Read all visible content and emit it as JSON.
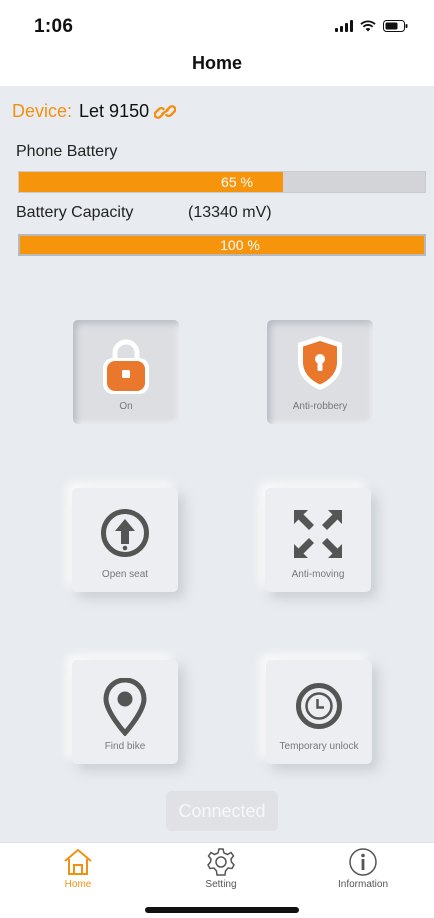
{
  "status_bar": {
    "time": "1:06"
  },
  "header": {
    "title": "Home"
  },
  "device": {
    "label": "Device:",
    "name": "Let 9150"
  },
  "phone_battery": {
    "label": "Phone Battery",
    "value_text": "65 %",
    "fraction": 0.65
  },
  "battery_capacity": {
    "label": "Battery Capacity",
    "voltage": "(13340 mV)",
    "value_text": "100 %",
    "fraction": 1.0
  },
  "controls": {
    "lock": {
      "label": "On",
      "icon": "padlock-icon"
    },
    "anti_robbery": {
      "label": "Anti-robbery",
      "icon": "shield-keyhole-icon"
    },
    "open_seat": {
      "label": "Open seat",
      "icon": "up-arrow-circle-icon"
    },
    "anti_moving": {
      "label": "Anti-moving",
      "icon": "arrows-inward-icon"
    },
    "find_bike": {
      "label": "Find bike",
      "icon": "map-pin-icon"
    },
    "temporary_unlock": {
      "label": "Temporary unlock",
      "icon": "clock-icon"
    }
  },
  "connection": {
    "status": "Connected"
  },
  "tabs": [
    {
      "label": "Home",
      "icon": "home-icon",
      "active": true
    },
    {
      "label": "Setting",
      "icon": "gear-icon",
      "active": false
    },
    {
      "label": "Information",
      "icon": "info-icon",
      "active": false
    }
  ],
  "colors": {
    "accent": "#f6940c",
    "background": "#e8ebef"
  }
}
